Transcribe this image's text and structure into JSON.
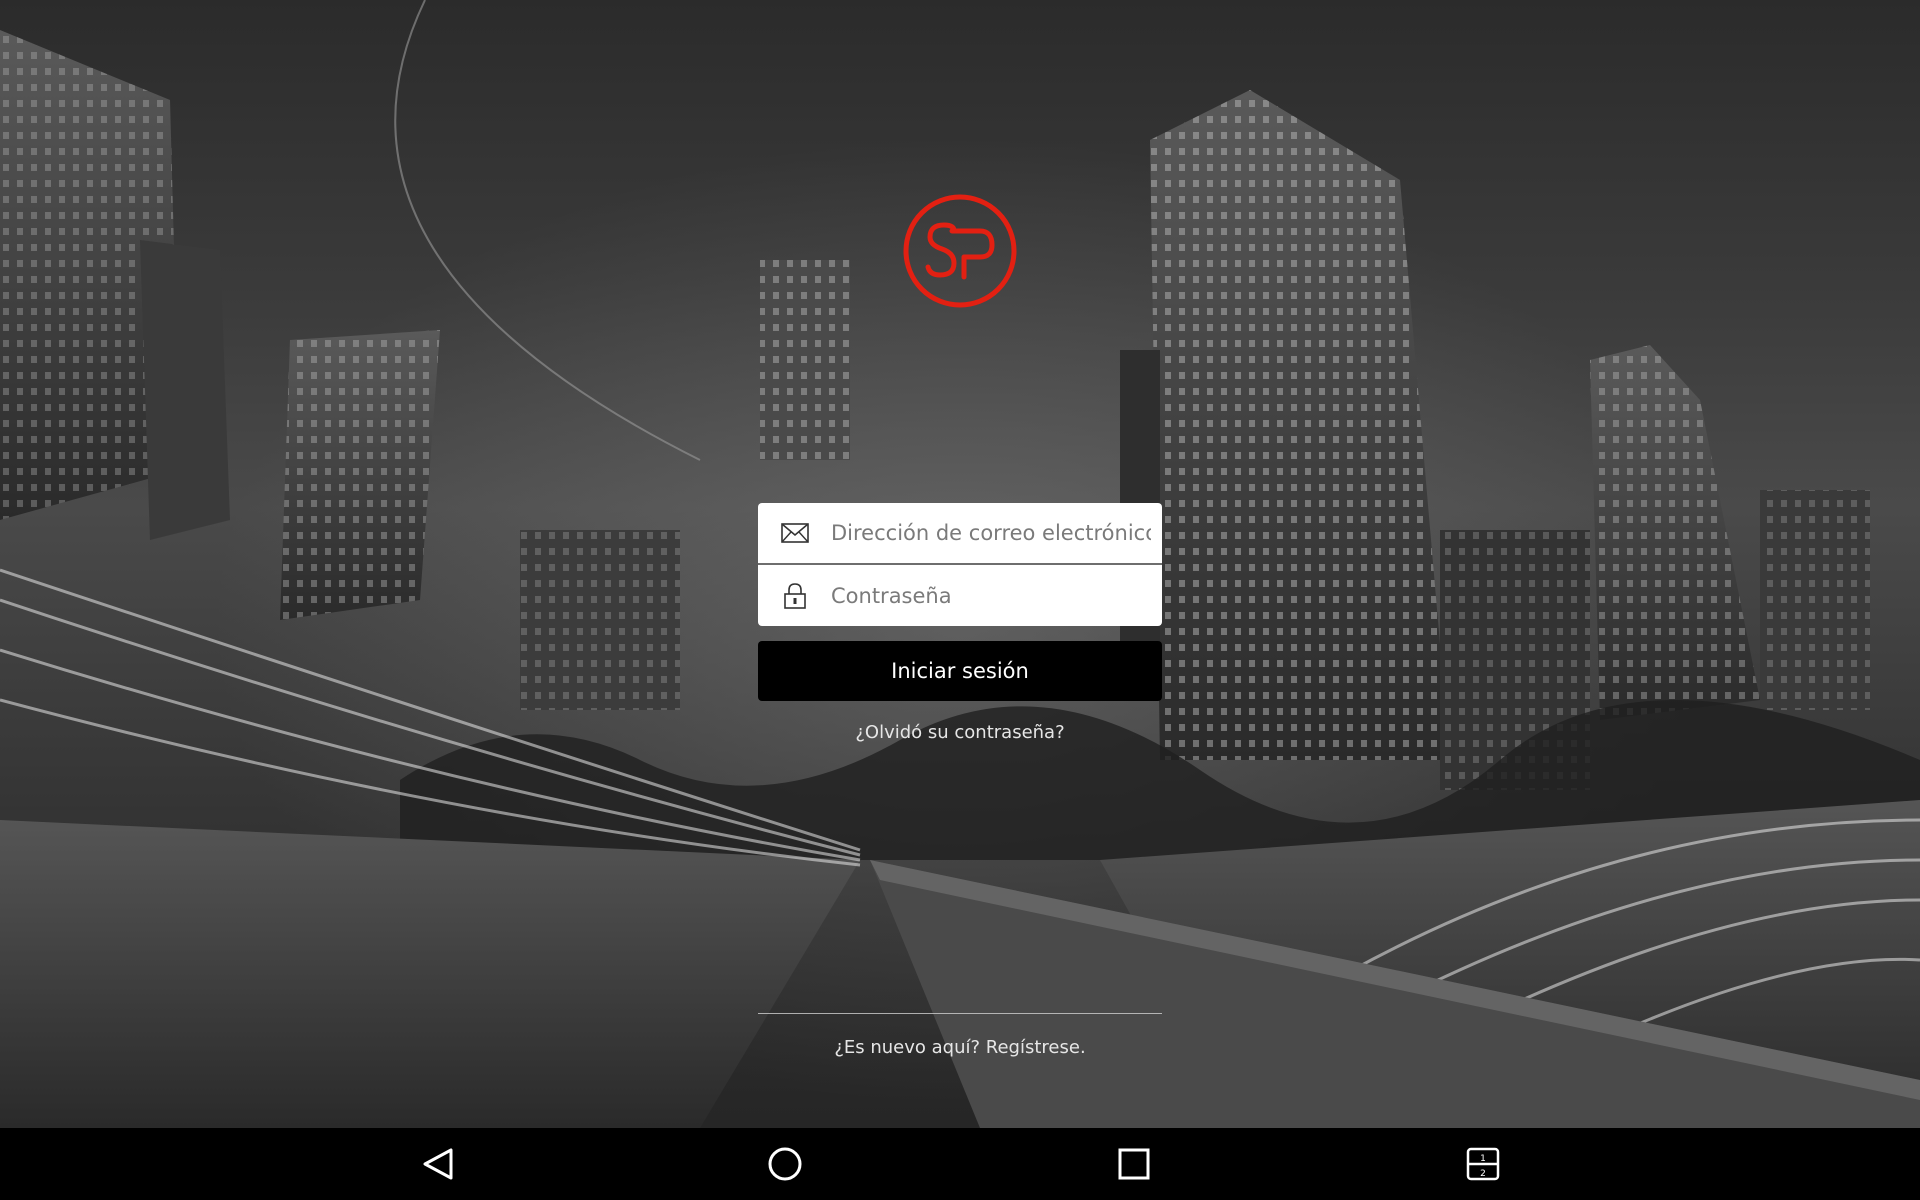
{
  "login": {
    "email_placeholder": "Dirección de correo electrónico",
    "password_placeholder": "Contraseña",
    "submit_label": "Iniciar sesión",
    "forgot_password": "¿Olvidó su contraseña?",
    "register_prompt": "¿Es nuevo aquí? Regístrese."
  },
  "icons": {
    "logo": "sp-logo",
    "email": "envelope-icon",
    "password": "lock-icon",
    "nav_back": "back-triangle-icon",
    "nav_home": "home-circle-icon",
    "nav_recents": "recents-square-icon",
    "nav_split": "split-screen-icon"
  },
  "nav_split_labels": [
    "1",
    "2"
  ],
  "colors": {
    "brand_red": "#e32012",
    "button_bg": "#000000",
    "field_bg": "#ffffff",
    "navbar_bg": "#000000"
  }
}
